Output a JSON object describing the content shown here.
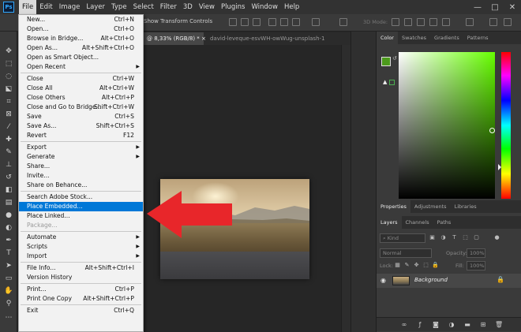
{
  "app": {
    "logo": "Ps"
  },
  "menubar": [
    "File",
    "Edit",
    "Image",
    "Layer",
    "Type",
    "Select",
    "Filter",
    "3D",
    "View",
    "Plugins",
    "Window",
    "Help"
  ],
  "window_controls": [
    "—",
    "□",
    "✕"
  ],
  "options_bar": {
    "transform_label": "Show Transform Controls",
    "mode_3d": "3D Mode:"
  },
  "doc_tabs": [
    {
      "label": "@ 8,33% (RGB/8) *",
      "close": "×"
    },
    {
      "label": "david-leveque-esvWH-owWug-unsplash-1"
    }
  ],
  "file_menu": {
    "items": [
      {
        "label": "New...",
        "shortcut": "Ctrl+N"
      },
      {
        "label": "Open...",
        "shortcut": "Ctrl+O"
      },
      {
        "label": "Browse in Bridge...",
        "shortcut": "Alt+Ctrl+O"
      },
      {
        "label": "Open As...",
        "shortcut": "Alt+Shift+Ctrl+O"
      },
      {
        "label": "Open as Smart Object...",
        "shortcut": ""
      },
      {
        "label": "Open Recent",
        "shortcut": "",
        "submenu": true
      },
      {
        "label": "Close",
        "shortcut": "Ctrl+W"
      },
      {
        "label": "Close All",
        "shortcut": "Alt+Ctrl+W"
      },
      {
        "label": "Close Others",
        "shortcut": "Alt+Ctrl+P"
      },
      {
        "label": "Close and Go to Bridge...",
        "shortcut": "Shift+Ctrl+W"
      },
      {
        "label": "Save",
        "shortcut": "Ctrl+S"
      },
      {
        "label": "Save As...",
        "shortcut": "Shift+Ctrl+S"
      },
      {
        "label": "Revert",
        "shortcut": "F12"
      },
      {
        "label": "Export",
        "shortcut": "",
        "submenu": true
      },
      {
        "label": "Generate",
        "shortcut": "",
        "submenu": true
      },
      {
        "label": "Share...",
        "shortcut": ""
      },
      {
        "label": "Invite...",
        "shortcut": ""
      },
      {
        "label": "Share on Behance...",
        "shortcut": ""
      },
      {
        "label": "Search Adobe Stock...",
        "shortcut": ""
      },
      {
        "label": "Place Embedded...",
        "shortcut": "",
        "highlight": true
      },
      {
        "label": "Place Linked...",
        "shortcut": ""
      },
      {
        "label": "Package...",
        "shortcut": "",
        "disabled": true
      },
      {
        "label": "Automate",
        "shortcut": "",
        "submenu": true
      },
      {
        "label": "Scripts",
        "shortcut": "",
        "submenu": true
      },
      {
        "label": "Import",
        "shortcut": "",
        "submenu": true
      },
      {
        "label": "File Info...",
        "shortcut": "Alt+Shift+Ctrl+I"
      },
      {
        "label": "Version History",
        "shortcut": ""
      },
      {
        "label": "Print...",
        "shortcut": "Ctrl+P"
      },
      {
        "label": "Print One Copy",
        "shortcut": "Alt+Shift+Ctrl+P"
      },
      {
        "label": "Exit",
        "shortcut": "Ctrl+Q"
      }
    ]
  },
  "color_panel": {
    "tabs": [
      "Color",
      "Swatches",
      "Gradients",
      "Patterns"
    ],
    "foreground": "#4c9a1c",
    "background": "#ffffff",
    "hue_color": "#66ff00"
  },
  "properties_tabs": [
    "Properties",
    "Adjustments",
    "Libraries"
  ],
  "layers_panel": {
    "tabs": [
      "Layers",
      "Channels",
      "Paths"
    ],
    "kind_label": "Kind",
    "blend_mode": "Normal",
    "opacity_label": "Opacity:",
    "opacity_value": "100%",
    "lock_label": "Lock:",
    "fill_label": "Fill:",
    "fill_value": "100%",
    "layers": [
      {
        "name": "Background",
        "visible": true,
        "locked": true
      }
    ]
  }
}
